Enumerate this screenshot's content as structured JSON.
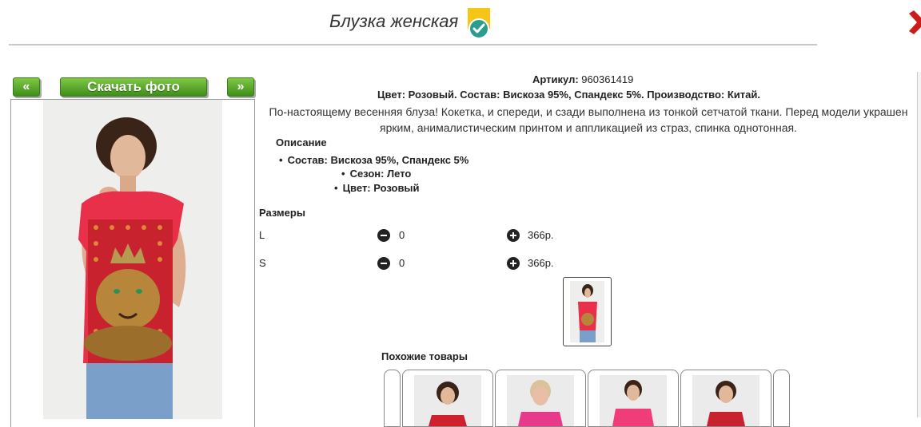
{
  "product": {
    "title": "Блузка женская",
    "article_label": "Артикул:",
    "article_value": "960361419",
    "summary": "Цвет: Розовый. Состав: Вискоза 95%, Спандекс 5%. Производство: Китай.",
    "description": "По-настоящему весенняя блуза! Кокетка, и спереди, и сзади выполнена из тонкой сетчатой ткани. Перед модели украшен ярким, анималистическим принтом и аппликацией из страз, спинка однотонная."
  },
  "photo_nav": {
    "prev_label": "«",
    "next_label": "»",
    "download_label": "Скачать фото"
  },
  "details": {
    "heading": "Описание",
    "items": [
      "Состав: Вискоза 95%, Спандекс 5%",
      "Сезон: Лето",
      "Цвет: Розовый"
    ]
  },
  "sizes": {
    "heading": "Размеры",
    "rows": [
      {
        "name": "L",
        "qty": "0",
        "price": "366р."
      },
      {
        "name": "S",
        "qty": "0",
        "price": "366р."
      }
    ]
  },
  "similar": {
    "heading": "Похожие товары"
  },
  "colors": {
    "button_green": "#4ea323",
    "badge_yellow": "#f5c518",
    "badge_teal": "#2a9d8f",
    "close_red": "#cc1b1b",
    "shirt_pink": "#e8304a"
  },
  "icons": [
    "verified-badge-icon",
    "close-icon",
    "minus-circle-icon",
    "plus-circle-icon"
  ]
}
